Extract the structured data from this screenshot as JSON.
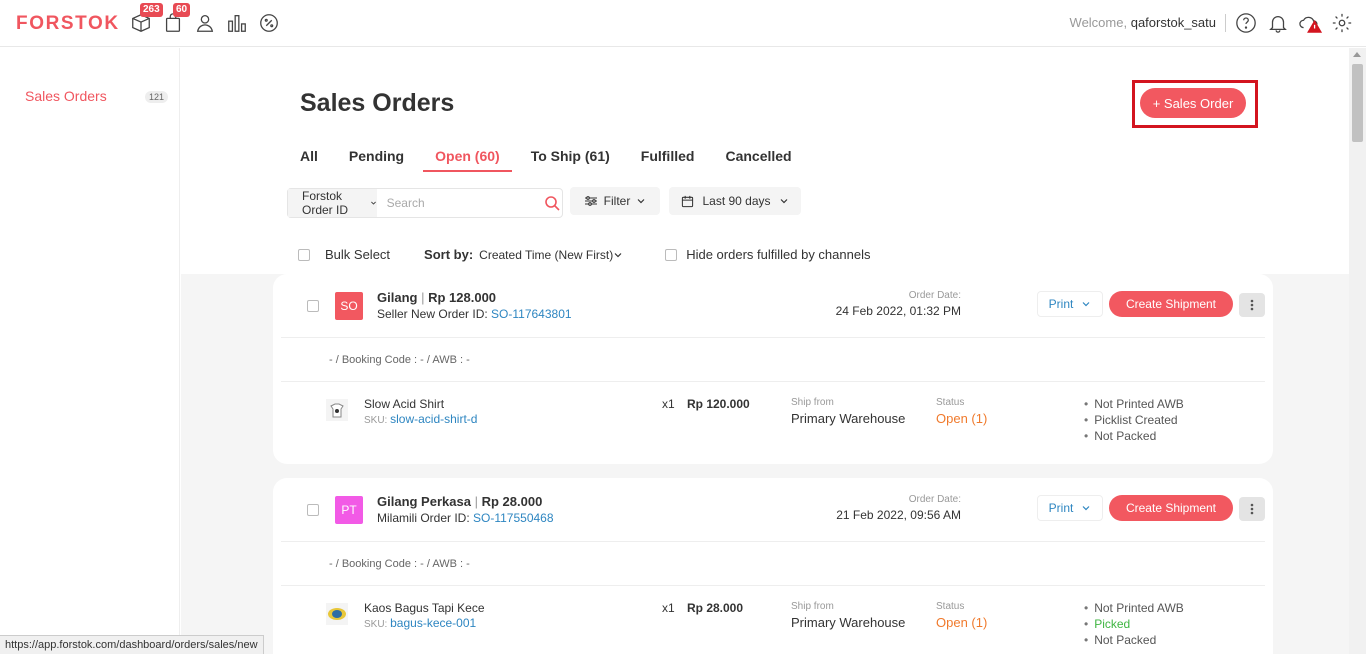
{
  "header": {
    "logo": "FORSTOK",
    "badges": {
      "inventory": "263",
      "orders": "60"
    },
    "welcome_prefix": "Welcome,",
    "username": "qaforstok_satu"
  },
  "sidebar": {
    "items": [
      {
        "label": "Sales Orders",
        "count": "121"
      }
    ]
  },
  "page": {
    "title": "Sales Orders",
    "add_button": "+ Sales Order",
    "tabs": [
      "All",
      "Pending",
      "Open (60)",
      "To Ship (61)",
      "Fulfilled",
      "Cancelled"
    ],
    "active_tab": "Open (60)"
  },
  "search": {
    "type": "Forstok Order ID",
    "placeholder": "Search"
  },
  "filter": {
    "label": "Filter"
  },
  "date_range": {
    "label": "Last 90 days"
  },
  "toolbar": {
    "bulk_select": "Bulk Select",
    "sort_label": "Sort by:",
    "sort_value": "Created Time (New First)",
    "hide_fulfilled": "Hide orders fulfilled by channels"
  },
  "orders": [
    {
      "avatar": "SO",
      "avatar_color": "#f25860",
      "customer": "Gilang",
      "total": "Rp 128.000",
      "channel_label": "Seller New Order ID:",
      "order_id": "SO-117643801",
      "date_label": "Order Date:",
      "date": "24 Feb 2022, 01:32 PM",
      "print_label": "Print",
      "ship_label": "Create Shipment",
      "booking": "- / Booking Code : - / AWB : -",
      "item": {
        "name": "Slow Acid Shirt",
        "sku_label": "SKU:",
        "sku": "slow-acid-shirt-d",
        "qty": "x1",
        "price": "Rp 120.000",
        "ship_from_label": "Ship from",
        "ship_from": "Primary Warehouse",
        "status_label": "Status",
        "status": "Open (1)",
        "checks": [
          "Not Printed AWB",
          "Picklist Created",
          "Not Packed"
        ]
      }
    },
    {
      "avatar": "PT",
      "avatar_color": "#f25ae6",
      "customer": "Gilang Perkasa",
      "total": "Rp 28.000",
      "channel_label": "Milamili Order ID:",
      "order_id": "SO-117550468",
      "date_label": "Order Date:",
      "date": "21 Feb 2022, 09:56 AM",
      "print_label": "Print",
      "ship_label": "Create Shipment",
      "booking": "- / Booking Code : - / AWB : -",
      "item": {
        "name": "Kaos Bagus Tapi Kece",
        "sku_label": "SKU:",
        "sku": "bagus-kece-001",
        "qty": "x1",
        "price": "Rp 28.000",
        "ship_from_label": "Ship from",
        "ship_from": "Primary Warehouse",
        "status_label": "Status",
        "status": "Open (1)",
        "checks": [
          "Not Printed AWB",
          "Picked",
          "Not Packed"
        ]
      }
    }
  ],
  "browser": {
    "status_url": "https://app.forstok.com/dashboard/orders/sales/new"
  },
  "colors": {
    "brand": "#f0565f",
    "link": "#2e86c1",
    "status_open": "#f07a2c",
    "picked": "#3fb542"
  }
}
